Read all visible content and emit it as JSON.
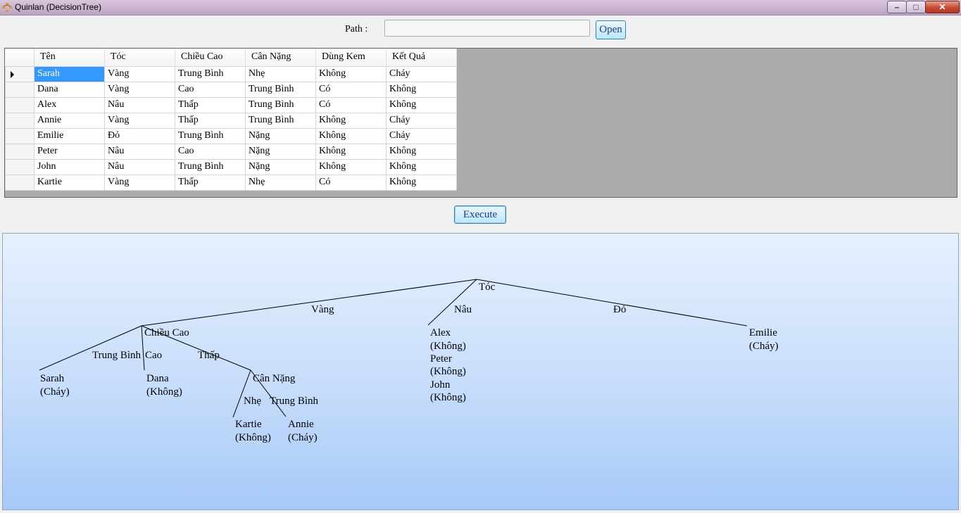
{
  "window": {
    "title": "Quinlan (DecisionTree)",
    "minimize_glyph": "–",
    "maximize_glyph": "□",
    "close_glyph": "✕"
  },
  "path": {
    "label": "Path :",
    "value": "",
    "open_label": "Open"
  },
  "grid": {
    "columns": [
      "Tên",
      "Tóc",
      "Chiều Cao",
      "Cân Nặng",
      "Dùng Kem",
      "Kết Quả"
    ],
    "rows": [
      [
        "Sarah",
        "Vàng",
        "Trung Bình",
        "Nhẹ",
        "Không",
        "Cháy"
      ],
      [
        "Dana",
        "Vàng",
        "Cao",
        "Trung Bình",
        "Có",
        "Không"
      ],
      [
        "Alex",
        "Nâu",
        "Thấp",
        "Trung Bình",
        "Có",
        "Không"
      ],
      [
        "Annie",
        "Vàng",
        "Thấp",
        "Trung Bình",
        "Không",
        "Cháy"
      ],
      [
        "Emilie",
        "Đỏ",
        "Trung Bình",
        "Nặng",
        "Không",
        "Cháy"
      ],
      [
        "Peter",
        "Nâu",
        "Cao",
        "Nặng",
        "Không",
        "Không"
      ],
      [
        "John",
        "Nâu",
        "Trung Bình",
        "Nặng",
        "Không",
        "Không"
      ],
      [
        "Kartie",
        "Vàng",
        "Thấp",
        "Nhẹ",
        "Có",
        "Không"
      ]
    ]
  },
  "execute_label": "Execute",
  "tree": {
    "root": "Tóc",
    "branches": {
      "vang": "Vàng",
      "nau": "Nâu",
      "do": "Đỏ"
    },
    "node_chieu_cao": "Chiều Cao",
    "cc_branches": {
      "trung_binh": "Trung Bình",
      "cao": "Cao",
      "thap": "Thấp"
    },
    "node_can_nang": "Cân Nặng",
    "cn_branches": {
      "nhe": "Nhẹ",
      "trung_binh": "Trung Bình"
    },
    "leaves": {
      "sarah": [
        "Sarah",
        "(Cháy)"
      ],
      "dana": [
        "Dana",
        "(Không)"
      ],
      "kartie": [
        "Kartie",
        "(Không)"
      ],
      "annie": [
        "Annie",
        "(Cháy)"
      ],
      "nau_group": [
        "Alex",
        "(Không)",
        "Peter",
        "(Không)",
        "John",
        "(Không)"
      ],
      "emilie": [
        "Emilie",
        "(Cháy)"
      ]
    }
  }
}
